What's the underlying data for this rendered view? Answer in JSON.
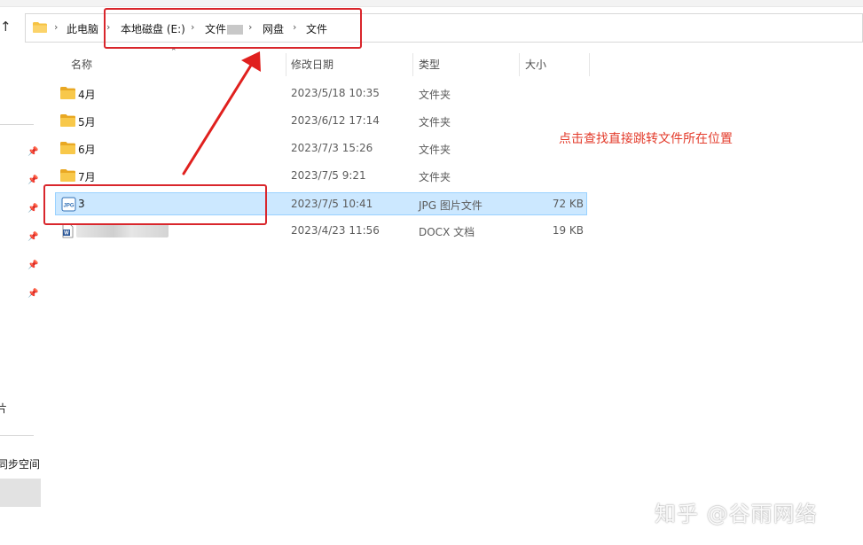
{
  "address_bar": {
    "crumbs": [
      "此电脑",
      "本地磁盘 (E:)",
      "文件",
      "网盘",
      "文件"
    ]
  },
  "columns": {
    "name": "名称",
    "date": "修改日期",
    "type": "类型",
    "size": "大小"
  },
  "files": [
    {
      "name": "4月",
      "date": "2023/5/18 10:35",
      "type": "文件夹",
      "size": "",
      "icon": "folder-icon"
    },
    {
      "name": "5月",
      "date": "2023/6/12 17:14",
      "type": "文件夹",
      "size": "",
      "icon": "folder-icon"
    },
    {
      "name": "6月",
      "date": "2023/7/3 15:26",
      "type": "文件夹",
      "size": "",
      "icon": "folder-icon"
    },
    {
      "name": "7月",
      "date": "2023/7/5 9:21",
      "type": "文件夹",
      "size": "",
      "icon": "folder-icon"
    },
    {
      "name": "3",
      "date": "2023/7/5 10:41",
      "type": "JPG 图片文件",
      "size": "72 KB",
      "icon": "jpg-file-icon",
      "selected": true
    },
    {
      "name": "",
      "date": "2023/4/23 11:56",
      "type": "DOCX 文档",
      "size": "19 KB",
      "icon": "docx-file-icon"
    }
  ],
  "nav_pane": {
    "partial_label_1": "片",
    "partial_label_2": "同步空间"
  },
  "annotation": {
    "text": "点击查找直接跳转文件所在位置",
    "color": "#e33b2b"
  },
  "watermark": "知乎 @谷雨网络",
  "colors": {
    "selection_bg": "#cce8ff",
    "selection_border": "#99d1ff",
    "highlight_red": "#d9262c",
    "folder_yellow": "#f6c343"
  }
}
